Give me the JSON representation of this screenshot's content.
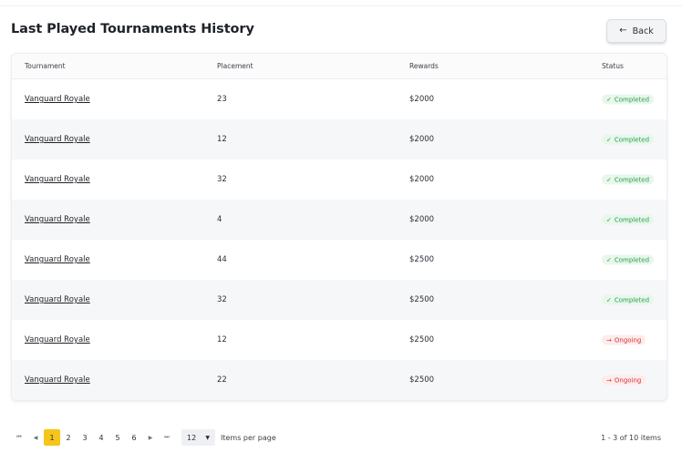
{
  "header": {
    "title": "Last Played Tournaments History",
    "back_label": "Back",
    "back_icon": "←"
  },
  "table": {
    "columns": [
      "Tournament",
      "Placement",
      "Rewards",
      "Status"
    ],
    "rows": [
      {
        "tournament": "Vanguard Royale",
        "placement": "23",
        "rewards": "$2000",
        "status": "Completed",
        "status_icon": "✓",
        "status_kind": "ok"
      },
      {
        "tournament": "Vanguard Royale",
        "placement": "12",
        "rewards": "$2000",
        "status": "Completed",
        "status_icon": "✓",
        "status_kind": "ok"
      },
      {
        "tournament": "Vanguard Royale",
        "placement": "32",
        "rewards": "$2000",
        "status": "Completed",
        "status_icon": "✓",
        "status_kind": "ok"
      },
      {
        "tournament": "Vanguard Royale",
        "placement": "4",
        "rewards": "$2000",
        "status": "Completed",
        "status_icon": "✓",
        "status_kind": "ok"
      },
      {
        "tournament": "Vanguard Royale",
        "placement": "44",
        "rewards": "$2500",
        "status": "Completed",
        "status_icon": "✓",
        "status_kind": "ok"
      },
      {
        "tournament": "Vanguard Royale",
        "placement": "32",
        "rewards": "$2500",
        "status": "Completed",
        "status_icon": "✓",
        "status_kind": "ok"
      },
      {
        "tournament": "Vanguard Royale",
        "placement": "12",
        "rewards": "$2500",
        "status": "Ongoing",
        "status_icon": "→",
        "status_kind": "bad"
      },
      {
        "tournament": "Vanguard Royale",
        "placement": "22",
        "rewards": "$2500",
        "status": "Ongoing",
        "status_icon": "→",
        "status_kind": "bad"
      }
    ]
  },
  "pagination": {
    "first_icon": "⏮",
    "prev_icon": "◀",
    "next_icon": "▶",
    "last_icon": "⏭",
    "pages": [
      "1",
      "2",
      "3",
      "4",
      "5",
      "6"
    ],
    "current_page": "1",
    "per_page_value": "12",
    "per_page_label": "Items per page",
    "info": "1 - 3 of 10 items"
  },
  "colors": {
    "accent": "#f5c518",
    "completed_text": "#2a9d4b",
    "completed_bg": "#e8f7ec",
    "ongoing_text": "#d6333b",
    "ongoing_bg": "#fdecec"
  }
}
